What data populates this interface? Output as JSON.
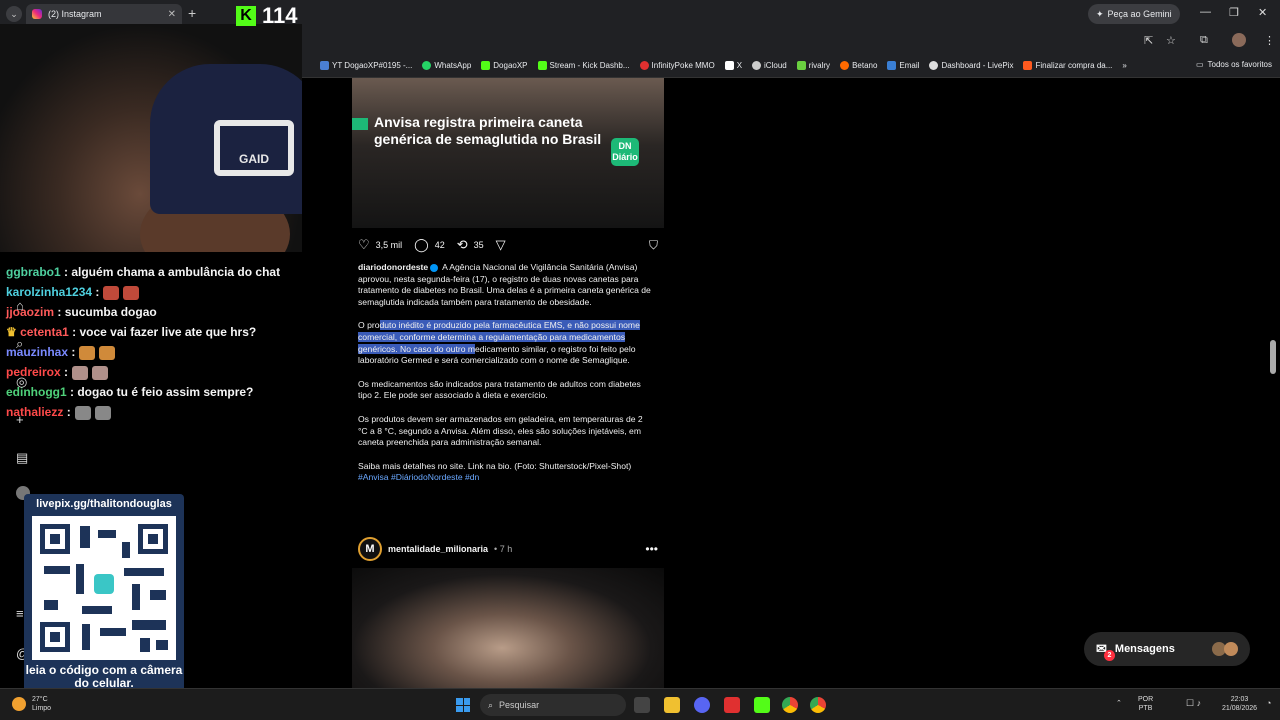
{
  "browser": {
    "tab_title": "(2) Instagram",
    "tab_close": "✕",
    "new_tab": "+",
    "tab_list": "⌄",
    "gemini_label": "Peça ao Gemini",
    "window_controls": [
      "—",
      "❐",
      "✕"
    ],
    "bookmarks": [
      {
        "label": "YT DogaoXP#0195 -...",
        "color": "#4a7fd4"
      },
      {
        "label": "WhatsApp",
        "color": "#25d366"
      },
      {
        "label": "DogaoXP",
        "color": "#53fc18"
      },
      {
        "label": "Stream - Kick Dashb...",
        "color": "#53fc18"
      },
      {
        "label": "InfinityPoke MMO",
        "color": "#e03030"
      },
      {
        "label": "X",
        "color": "#ffffff"
      },
      {
        "label": "iCloud",
        "color": "#cccccc"
      },
      {
        "label": "rivalry",
        "color": "#6ad040"
      },
      {
        "label": "Betano",
        "color": "#ff6a00"
      },
      {
        "label": "Email",
        "color": "#3a7fd4"
      },
      {
        "label": "Dashboard - LivePix",
        "color": "#dddddd"
      },
      {
        "label": "Finalizar compra da...",
        "color": "#ff5a1f"
      }
    ],
    "bookmarks_more": "»",
    "all_favorites": "Todos os favoritos"
  },
  "stream": {
    "kick_logo": "K",
    "viewer_count": "114",
    "cap_brand": "GAID",
    "chat": [
      {
        "user": "ggbrabo1",
        "color": "#4fd1a0",
        "text": ": alguém chama a ambulância do chat",
        "emotes": []
      },
      {
        "user": "karolzinha1234",
        "color": "#4fd1e0",
        "text": ":",
        "emotes": [
          "#c04a3a",
          "#c04a3a"
        ]
      },
      {
        "user": "jjoaozim",
        "color": "#ff5a5a",
        "text": ": sucumba dogao",
        "emotes": []
      },
      {
        "user": "cetenta1",
        "color": "#ff5a5a",
        "text": ": voce vai fazer live ate que hrs?",
        "emotes": []
      },
      {
        "user": "mauzinhax",
        "color": "#7a8aff",
        "text": ":",
        "emotes": [
          "#d08a3a",
          "#d08a3a"
        ]
      },
      {
        "user": "pedreirox",
        "color": "#ff4a4a",
        "text": ":",
        "emotes": [
          "#b0908a",
          "#b0908a"
        ]
      },
      {
        "user": "edinhogg1",
        "color": "#4fd17a",
        "text": ": dogao tu é feio assim sempre?",
        "emotes": []
      },
      {
        "user": "nathaliezz",
        "color": "#ff4a4a",
        "text": ":",
        "emotes": [
          "#888888",
          "#888888"
        ]
      }
    ],
    "qr": {
      "url": "livepix.gg/thalitondouglas",
      "cta": "leia o código com a câmera do celular."
    }
  },
  "post1": {
    "headline": "Anvisa registra primeira caneta genérica de semaglutida no Brasil",
    "logo": "DN Diário",
    "likes": "3,5 mil",
    "comments": "42",
    "reposts": "35",
    "username": "diariodonordeste",
    "caption_p1": "A Agência Nacional de Vigilância Sanitária (Anvisa) aprovou, nesta segunda-feira (17), o registro de duas novas canetas para tratamento de diabetes no Brasil. Uma delas é a primeira caneta genérica de semaglutida indicada também para tratamento de obesidade.",
    "caption_p2_pre": "O pro",
    "caption_p2_hl": "duto inédito é produzido pela farmacêutica EMS, e não possui nome comercial, conforme determina a regulamentação para medicamentos genéricos. No caso do outro m",
    "caption_p2_post": "edicamento similar, o registro foi feito pelo laboratório Germed e será comercializado com o nome de Semaglique.",
    "caption_p3": "Os medicamentos são indicados para tratamento de adultos com diabetes tipo 2. Ele pode ser associado à dieta e exercício.",
    "caption_p4": "Os produtos devem ser armazenados em geladeira, em temperaturas de 2 °C a 8 °C, segundo a Anvisa. Além disso, eles são soluções injetáveis, em caneta preenchida para administração semanal.",
    "caption_p5": "Saiba mais detalhes no site. Link na bio. (Foto: Shutterstock/Pixel-Shot)",
    "tags": "#Anvisa #DiáriodoNordeste #dn"
  },
  "post2": {
    "avatar": "M",
    "username": "mentalidade_milionaria",
    "time": "• 7 h",
    "more": "•••"
  },
  "messages": {
    "label": "Mensagens",
    "badge": "2"
  },
  "taskbar": {
    "weather_temp": "27°C",
    "weather_desc": "Limpo",
    "search_placeholder": "Pesquisar",
    "lang": "POR",
    "kbd": "PTB",
    "time": "22:03",
    "date": "21/08/2026"
  }
}
